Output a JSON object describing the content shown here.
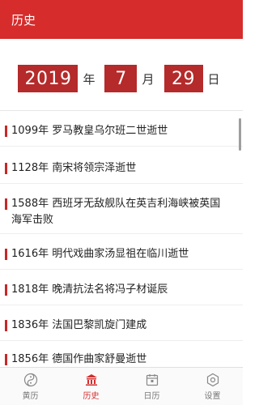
{
  "app_bar": {
    "title": "历史"
  },
  "date": {
    "year": "2019",
    "year_unit": "年",
    "month": "7",
    "month_unit": "月",
    "day": "29",
    "day_unit": "日"
  },
  "events": [
    {
      "text": "1099年 罗马教皇乌尔班二世逝世"
    },
    {
      "text": "1128年 南宋将领宗泽逝世"
    },
    {
      "text": "1588年 西班牙无敌舰队在英吉利海峡被英国海军击败"
    },
    {
      "text": "1616年 明代戏曲家汤显祖在临川逝世"
    },
    {
      "text": "1818年 晚清抗法名将冯子材诞辰"
    },
    {
      "text": "1836年 法国巴黎凯旋门建成"
    },
    {
      "text": "1856年 德国作曲家舒曼逝世"
    }
  ],
  "bottom_nav": {
    "items": [
      {
        "label": "黄历",
        "icon": "yin-yang-icon"
      },
      {
        "label": "历史",
        "icon": "landmark-icon",
        "active": true
      },
      {
        "label": "日历",
        "icon": "calendar-icon"
      },
      {
        "label": "设置",
        "icon": "gear-icon"
      }
    ]
  },
  "colors": {
    "primary": "#d62c2c",
    "date_box": "#b52a2a",
    "accent_bar": "#c62828"
  }
}
